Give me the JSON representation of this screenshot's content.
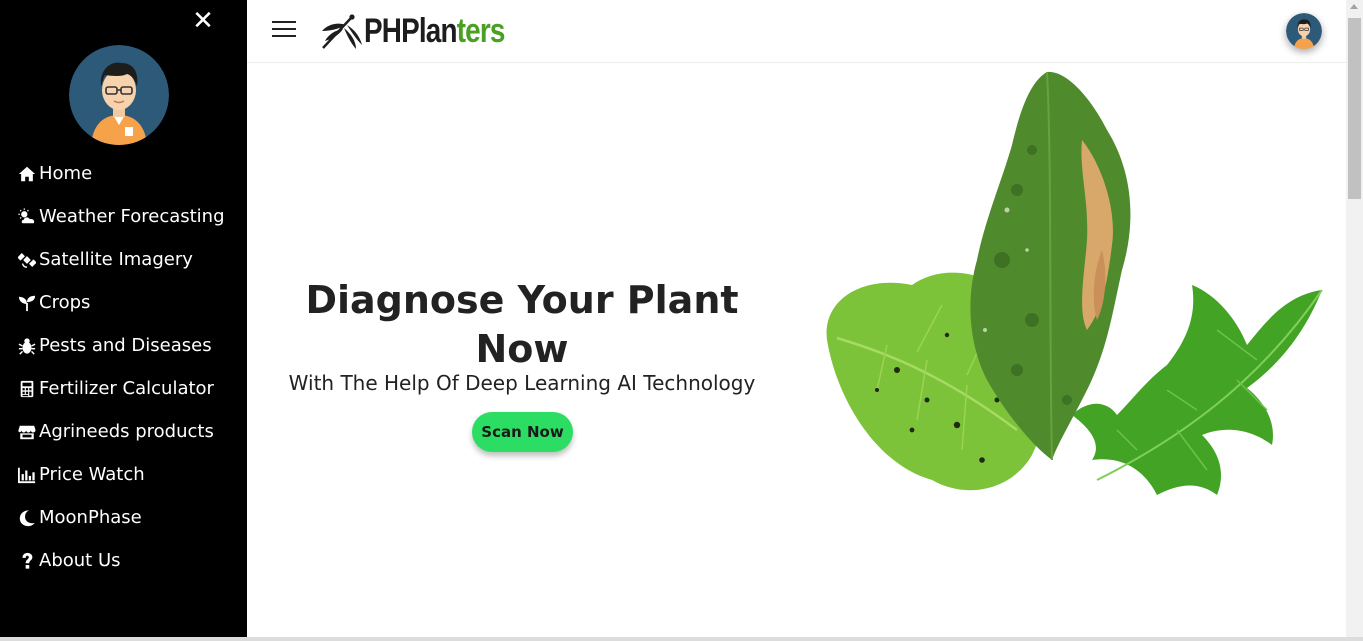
{
  "sidebar": {
    "close_label": "✕",
    "items": [
      {
        "label": "Home",
        "icon": "home-icon"
      },
      {
        "label": "Weather Forecasting",
        "icon": "cloud-sun-icon"
      },
      {
        "label": "Satellite Imagery",
        "icon": "satellite-icon"
      },
      {
        "label": "Crops",
        "icon": "seedling-icon"
      },
      {
        "label": "Pests and Diseases",
        "icon": "bug-icon"
      },
      {
        "label": "Fertilizer Calculator",
        "icon": "calculator-icon"
      },
      {
        "label": "Agrineeds products",
        "icon": "store-icon"
      },
      {
        "label": "Price Watch",
        "icon": "chart-bar-icon"
      },
      {
        "label": "MoonPhase",
        "icon": "moon-icon"
      },
      {
        "label": "About Us",
        "icon": "question-icon"
      }
    ]
  },
  "header": {
    "logo_part1": "PHPlan",
    "logo_part2": "ters"
  },
  "hero": {
    "title": "Diagnose Your Plant Now",
    "subtitle": "With The Help Of Deep Learning AI Technology",
    "button_label": "Scan Now"
  },
  "colors": {
    "sidebar_bg": "#000000",
    "brand_green": "#49a022",
    "button_green": "#2bdd62"
  }
}
